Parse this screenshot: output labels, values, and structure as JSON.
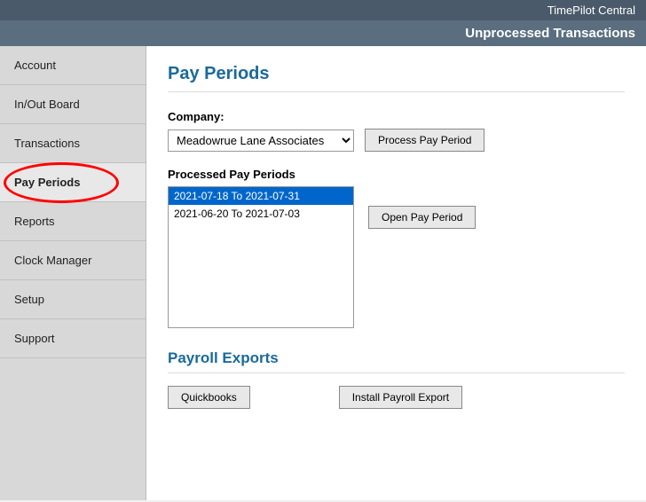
{
  "app": {
    "name": "TimePilot Central",
    "subtitle": "Unprocessed Transactions"
  },
  "sidebar": {
    "items": [
      {
        "id": "account",
        "label": "Account",
        "active": false
      },
      {
        "id": "inout-board",
        "label": "In/Out Board",
        "active": false
      },
      {
        "id": "transactions",
        "label": "Transactions",
        "active": false
      },
      {
        "id": "pay-periods",
        "label": "Pay Periods",
        "active": true
      },
      {
        "id": "reports",
        "label": "Reports",
        "active": false
      },
      {
        "id": "clock-manager",
        "label": "Clock Manager",
        "active": false
      },
      {
        "id": "setup",
        "label": "Setup",
        "active": false
      },
      {
        "id": "support",
        "label": "Support",
        "active": false
      }
    ]
  },
  "main": {
    "title": "Pay Periods",
    "company_label": "Company:",
    "company_value": "Meadowrue Lane Associates",
    "company_options": [
      "Meadowrue Lane Associates"
    ],
    "process_pay_period_btn": "Process Pay Period",
    "processed_label": "Processed Pay Periods",
    "pay_periods": [
      {
        "id": 1,
        "label": "2021-07-18 To 2021-07-31",
        "selected": true
      },
      {
        "id": 2,
        "label": "2021-06-20 To 2021-07-03",
        "selected": false
      }
    ],
    "open_pay_period_btn": "Open Pay Period",
    "payroll_exports_title": "Payroll Exports",
    "quickbooks_btn": "Quickbooks",
    "install_payroll_export_btn": "Install Payroll Export"
  }
}
